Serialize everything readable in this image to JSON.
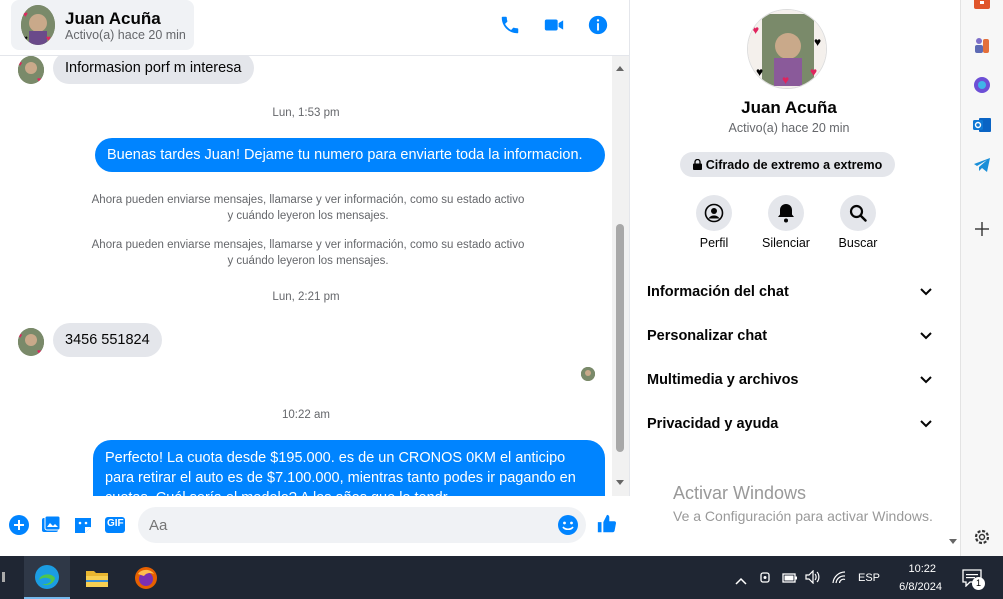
{
  "header": {
    "name": "Juan Acuña",
    "status": "Activo(a) hace 20 min"
  },
  "messages": {
    "first_incoming": "Informasion porf m interesa",
    "ts1": "Lun, 1:53 pm",
    "outgoing1": "Buenas tardes Juan! Dejame tu numero para enviarte toda la informacion.",
    "sys1": "Ahora pueden enviarse mensajes, llamarse y ver información, como su estado activo y cuándo leyeron los mensajes.",
    "sys2": "Ahora pueden enviarse mensajes, llamarse y ver información, como su estado activo y cuándo leyeron los mensajes.",
    "ts2": "Lun, 2:21 pm",
    "incoming_number": "3456 551824",
    "ts3": "10:22 am",
    "outgoing2": "Perfecto! La cuota desde $195.000. es de un CRONOS 0KM el anticipo para retirar el auto es de $7.100.000, mientras tanto podes ir pagando en cuotas. Cuál sería el modelo? A los años que lo tendr..."
  },
  "composer": {
    "placeholder": "Aa",
    "gif_label": "GIF"
  },
  "sidebar": {
    "name": "Juan Acuña",
    "status": "Activo(a) hace 20 min",
    "encryption": "Cifrado de extremo a extremo",
    "actions": [
      "Perfil",
      "Silenciar",
      "Buscar"
    ],
    "sections": [
      "Información del chat",
      "Personalizar chat",
      "Multimedia y archivos",
      "Privacidad y ayuda"
    ]
  },
  "watermark": {
    "line1": "Activar Windows",
    "line2": "Ve a Configuración para activar Windows."
  },
  "taskbar": {
    "lang": "ESP",
    "time": "10:22",
    "date": "6/8/2024",
    "notif_count": "1"
  },
  "colors": {
    "accent": "#0084ff",
    "bubble_in": "#e4e6eb"
  }
}
